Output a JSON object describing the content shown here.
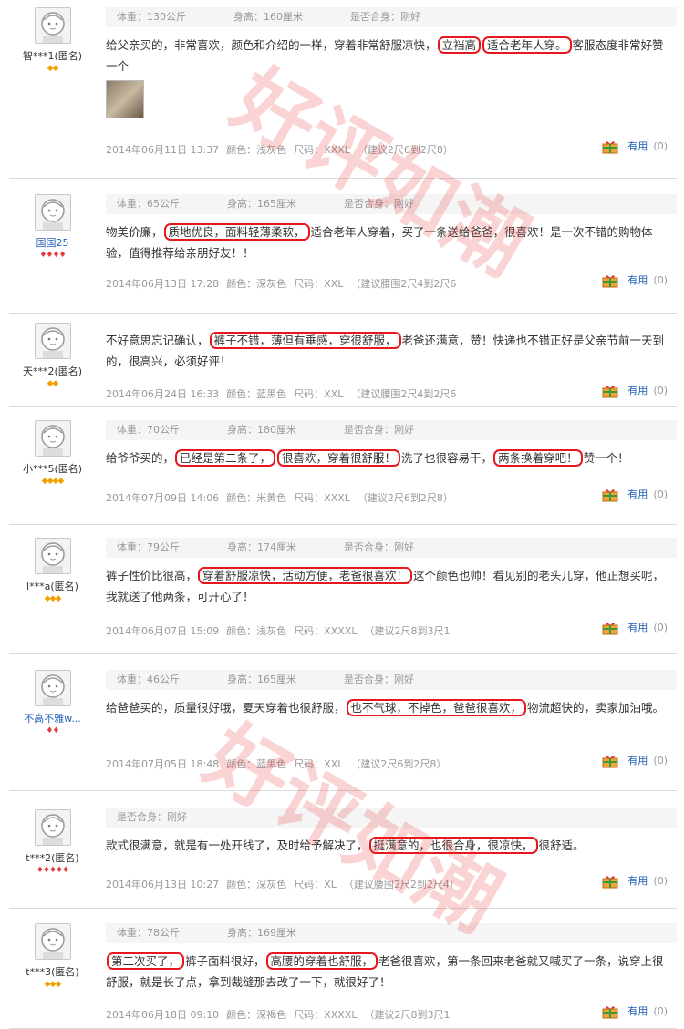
{
  "watermark_text": "好评如潮",
  "useful_label": "有用",
  "reviews": [
    {
      "user": "智***1(匿名)",
      "level": "◆◆",
      "level_color": "gold",
      "name_color": "dark",
      "meta": [
        "体重：130公斤",
        "身高：160厘米",
        "是否合身：刚好"
      ],
      "text_before": "给父亲买的，非常喜欢，颜色和介绍的一样，穿着非常舒服凉快，",
      "highlights": [
        "立裆高",
        "适合老年人穿。"
      ],
      "text_after": "客服态度非常好赞一个",
      "has_image": true,
      "date": "2014年06月11日 13:37",
      "color": "颜色：浅灰色",
      "size": "尺码：XXXL",
      "suggest": "（建议2尺6到2尺8）",
      "useful": "(0)"
    },
    {
      "user": "国国25",
      "level": "♦♦♦♦",
      "level_color": "red",
      "name_color": "blue",
      "meta": [
        "体重：65公斤",
        "身高：165厘米",
        "是否合身：刚好"
      ],
      "text_before": "物美价廉，",
      "highlights": [
        "质地优良，面料轻薄柔软，"
      ],
      "text_after": "适合老年人穿着，买了一条送给爸爸，很喜欢！是一次不错的购物体验，值得推荐给亲朋好友！！",
      "has_image": false,
      "date": "2014年06月13日 17:28",
      "color": "颜色：深灰色",
      "size": "尺码：XXL",
      "suggest": "（建议腰围2尺4到2尺6",
      "useful": "(0)"
    },
    {
      "user": "天***2(匿名)",
      "level": "◆◆",
      "level_color": "gold",
      "name_color": "dark",
      "meta": [],
      "text_before": "不好意思忘记确认，",
      "highlights": [
        "裤子不错，薄但有垂感，穿很舒服，"
      ],
      "text_after": "老爸还满意，赞！快递也不错正好是父亲节前一天到的，很高兴，必须好评！",
      "has_image": false,
      "date": "2014年06月24日 16:33",
      "color": "颜色：蓝黑色",
      "size": "尺码：XXL",
      "suggest": "（建议腰围2尺4到2尺6",
      "useful": "(0)"
    },
    {
      "user": "小***5(匿名)",
      "level": "◆◆◆◆",
      "level_color": "gold",
      "name_color": "dark",
      "meta": [
        "体重：70公斤",
        "身高：180厘米",
        "是否合身：刚好"
      ],
      "text_before": "给爷爷买的，",
      "highlights": [
        "已经是第二条了，",
        "很喜欢，穿着很舒服！",
        "两条换着穿吧！"
      ],
      "text_mid": [
        "",
        "洗了也很容易干，"
      ],
      "text_after": "赞一个！",
      "has_image": false,
      "date": "2014年07月09日 14:06",
      "color": "颜色：米黄色",
      "size": "尺码：XXXL",
      "suggest": "（建议2尺6到2尺8）",
      "useful": "(0)"
    },
    {
      "user": "l***a(匿名)",
      "level": "◆◆◆",
      "level_color": "gold",
      "name_color": "dark",
      "meta": [
        "体重：79公斤",
        "身高：174厘米",
        "是否合身：刚好"
      ],
      "text_before": "裤子性价比很高，",
      "highlights": [
        "穿着舒服凉快，活动方便，老爸很喜欢！"
      ],
      "text_after": "这个颜色也帅！看见别的老头儿穿，他正想买呢，我就送了他两条，可开心了！",
      "has_image": false,
      "date": "2014年06月07日 15:09",
      "color": "颜色：浅灰色",
      "size": "尺码：XXXXL",
      "suggest": "（建议2尺8到3尺1",
      "useful": "(0)"
    },
    {
      "user": "不高不雅w...",
      "level": "♦♦",
      "level_color": "red",
      "name_color": "blue",
      "meta": [
        "体重：46公斤",
        "身高：165厘米",
        "是否合身：刚好"
      ],
      "text_before": "给爸爸买的，质量很好哦，夏天穿着也很舒服，",
      "highlights": [
        "也不气球，不掉色，爸爸很喜欢，"
      ],
      "text_after": "物流超快的，卖家加油哦。",
      "has_image": false,
      "date": "2014年07月05日 18:48",
      "color": "颜色：蓝黑色",
      "size": "尺码：XXL",
      "suggest": "（建议2尺6到2尺8）",
      "useful": "(0)"
    },
    {
      "user": "t***2(匿名)",
      "level": "♦♦♦♦♦",
      "level_color": "red",
      "name_color": "dark",
      "meta": [
        "是否合身：刚好"
      ],
      "text_before": "款式很满意，就是有一处开线了，及时给予解决了，",
      "highlights": [
        "挺满意的，也很合身，很凉快，"
      ],
      "text_after": "很舒适。",
      "has_image": false,
      "date": "2014年06月13日 10:27",
      "color": "颜色：深灰色",
      "size": "尺码：XL",
      "suggest": "（建议腰围2尺2到2尺4）",
      "useful": "(0)"
    },
    {
      "user": "t***3(匿名)",
      "level": "◆◆◆",
      "level_color": "gold",
      "name_color": "dark",
      "meta": [
        "体重：78公斤",
        "身高：169厘米"
      ],
      "text_before": "",
      "highlights": [
        "第二次买了，",
        "高腰的穿着也舒服，"
      ],
      "text_mid": [
        "裤子面料很好，"
      ],
      "text_after": "老爸很喜欢，第一条回来老爸就又喊买了一条，说穿上很舒服，就是长了点，拿到裁缝那去改了一下，就很好了！",
      "has_image": false,
      "date": "2014年06月18日 09:10",
      "color": "颜色：深褐色",
      "size": "尺码：XXXXL",
      "suggest": "（建议2尺8到3尺1",
      "useful": "(0)"
    }
  ]
}
